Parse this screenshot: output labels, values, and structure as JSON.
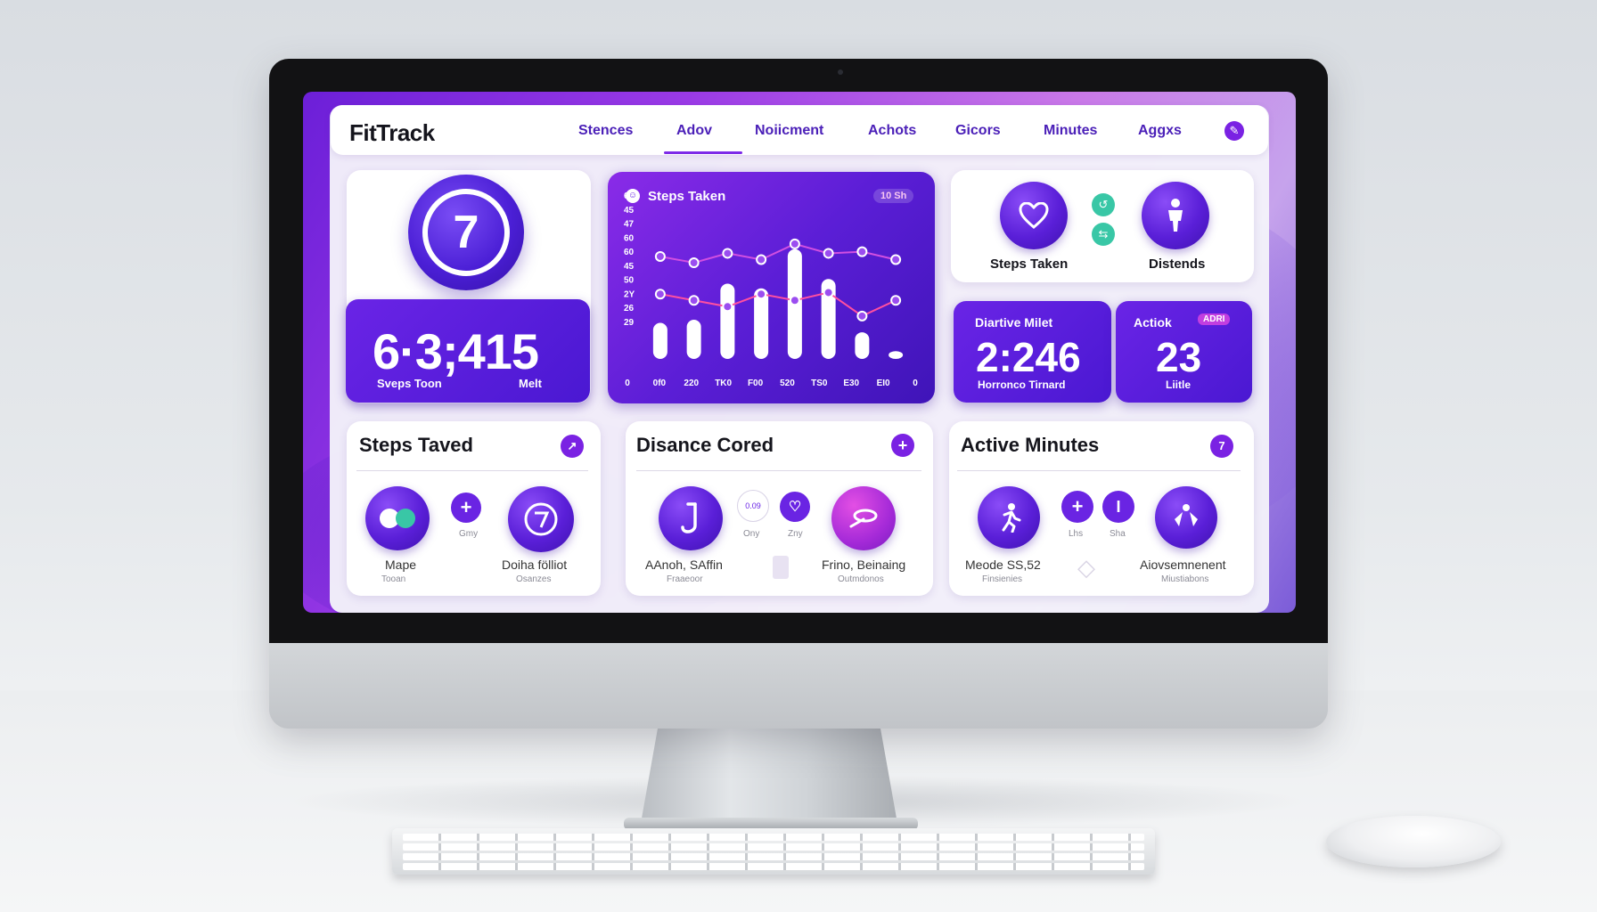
{
  "app": {
    "name": "FitTrack"
  },
  "nav": {
    "items": [
      "Stences",
      "Adov",
      "Noiicment",
      "Achots",
      "Gicors",
      "Minutes",
      "Aggxs"
    ],
    "active_index": 1
  },
  "hero": {
    "badge_number": "7",
    "steps_value": "6·3;415",
    "steps_label": "Sveps Toon",
    "unit_label": "Melt"
  },
  "chart_card": {
    "title": "Steps Taken",
    "badge": "10 Sh",
    "y_ticks": [
      "60",
      "45",
      "47",
      "60",
      "60",
      "45",
      "50",
      "2Y",
      "26",
      "29"
    ],
    "x_ticks": [
      "0",
      "0f0",
      "220",
      "TK0",
      "F00",
      "520",
      "TS0",
      "E30",
      "EI0",
      "0"
    ]
  },
  "chart_data": {
    "type": "bar",
    "title": "Steps Taken",
    "categories": [
      "0f0",
      "220",
      "TK0",
      "F00",
      "520",
      "TS0",
      "E30",
      "EI0"
    ],
    "series": [
      {
        "values": [
          23,
          25,
          48,
          45,
          70,
          51,
          17,
          5
        ]
      },
      {
        "values": [
          54,
          50,
          56,
          52,
          62,
          56,
          57,
          52
        ]
      },
      {
        "values": [
          30,
          26,
          22,
          30,
          26,
          31,
          16,
          26
        ]
      }
    ],
    "xlabel": "",
    "ylabel": "",
    "ylim": [
      0,
      75
    ]
  },
  "stats_top": {
    "icons": [
      {
        "label": "Steps Taken",
        "icon": "heart-icon"
      },
      {
        "label": "Distends",
        "icon": "person-icon"
      }
    ]
  },
  "mid_cards": [
    {
      "title": "Diartive Milet",
      "value": "2:246",
      "caption": "Horronco Tirnard"
    },
    {
      "title": "Actiok",
      "badge": "ADRI",
      "value": "23",
      "caption": "Liitle"
    }
  ],
  "bottom_cards": [
    {
      "title": "Steps Taved",
      "items": [
        {
          "label": "Mape",
          "sub": "Tooan"
        },
        {
          "label": "Doiha fölliot",
          "sub": "Osanzes"
        }
      ],
      "mini_label": "Gmy"
    },
    {
      "title": "Disance Cored",
      "items": [
        {
          "label": "AAnoh, SAffin",
          "sub": "Fraaeoor"
        },
        {
          "label": "Frino, Beinaing",
          "sub": "Outmdonos"
        }
      ],
      "mini_labels": [
        "Ony",
        "Zny"
      ],
      "mini_value": "0.09"
    },
    {
      "title": "Active Minutes",
      "items": [
        {
          "label": "Meode SS,52",
          "sub": "Finsienies"
        },
        {
          "label": "Aiovsemnenent",
          "sub": "Miustiabons"
        }
      ],
      "mini_labels": [
        "Lhs",
        "Sha"
      ]
    }
  ],
  "colors": {
    "accent": "#6a24e6",
    "accent_dark": "#4a18d2",
    "magenta": "#e23ad1",
    "teal": "#39c7a6"
  }
}
